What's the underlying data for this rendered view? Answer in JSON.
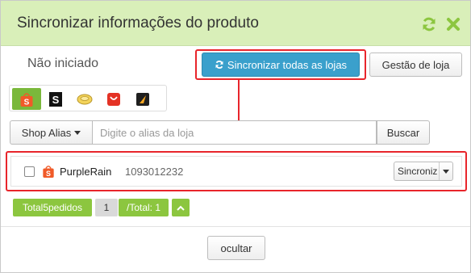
{
  "dialog": {
    "title": "Sincronizar informações do produto",
    "header_icons": [
      "refresh-icon",
      "close-icon"
    ],
    "status": "Não iniciado",
    "sync_all_label": "Sincronizar todas as lojas",
    "store_mgmt_label": "Gestão de loja"
  },
  "platforms": [
    {
      "name": "shopee",
      "glyph": "S",
      "active": true
    },
    {
      "name": "shein",
      "glyph": "S",
      "active": false
    },
    {
      "name": "lazada-coin",
      "glyph": "",
      "active": false
    },
    {
      "name": "aliexpress",
      "glyph": "",
      "active": false
    },
    {
      "name": "mercado-play",
      "glyph": "",
      "active": false
    }
  ],
  "search": {
    "alias_label": "Shop Alias",
    "placeholder": "Digite o alias da loja",
    "value": "",
    "button": "Buscar"
  },
  "stores": [
    {
      "name": "PurpleRain",
      "id": "1093012232",
      "action": "Sincroniz"
    }
  ],
  "pagination": {
    "total_label": "Total5pedidos",
    "page": "1",
    "of_total": "/Total: 1"
  },
  "footer": {
    "hide_label": "ocultar"
  },
  "colors": {
    "header_bg": "#d9efb9",
    "accent_green": "#8cc63f",
    "primary_blue": "#3aa0cc",
    "highlight_red": "#e8252b"
  }
}
